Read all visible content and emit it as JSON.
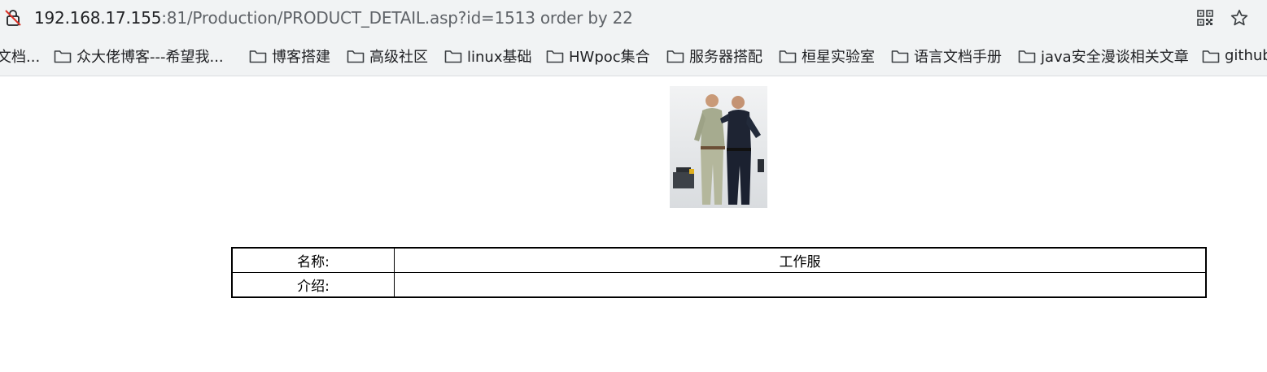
{
  "browser": {
    "url_host": "192.168.17.155",
    "url_rest": ":81/Production/PRODUCT_DETAIL.asp?id=1513 order by 22",
    "icons": {
      "security": "not-secure-lock-icon",
      "qr": "qr-code-icon",
      "bookmark_star": "star-icon"
    }
  },
  "bookmarks": {
    "items": [
      {
        "label": "文档..."
      },
      {
        "label": "众大佬博客---希望我..."
      },
      {
        "label": "博客搭建"
      },
      {
        "label": "高级社区"
      },
      {
        "label": "linux基础"
      },
      {
        "label": "HWpoc集合"
      },
      {
        "label": "服务器搭配"
      },
      {
        "label": "桓星实验室"
      },
      {
        "label": "语言文档手册"
      },
      {
        "label": "java安全漫谈相关文章"
      },
      {
        "label": "github"
      }
    ]
  },
  "product": {
    "name_label": "名称:",
    "name_value": "工作服",
    "intro_label": "介绍:",
    "intro_value": ""
  }
}
